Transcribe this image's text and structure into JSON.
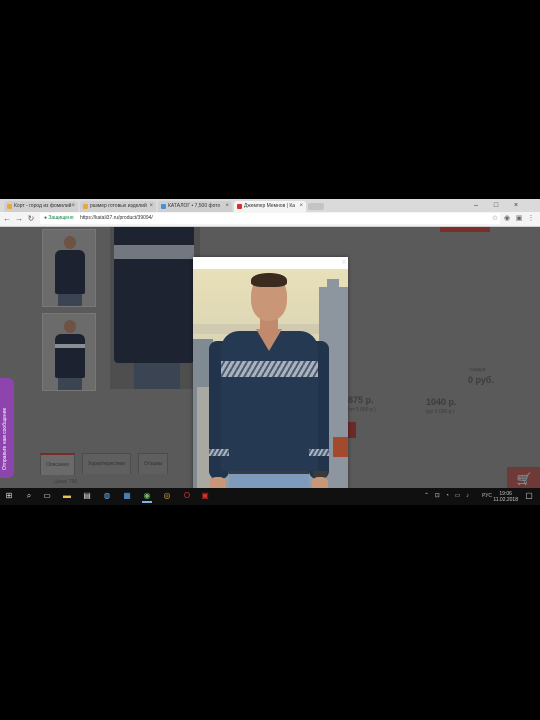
{
  "browser": {
    "tabs": [
      {
        "label": "Корт - город из фомилий",
        "active": false,
        "favicon_color": "#e8a93b"
      },
      {
        "label": "размер готовых изделий",
        "active": false,
        "favicon_color": "#e8a93b"
      },
      {
        "label": "КАТАЛОГ • 7,500 фото",
        "active": false,
        "favicon_color": "#4a90d9"
      },
      {
        "label": "Джемпер Мемнов | Ка",
        "active": true,
        "favicon_color": "#d9302a"
      }
    ],
    "window_controls": {
      "minimize": "–",
      "maximize": "□",
      "close": "×"
    },
    "address": {
      "secure_label": "● Защищено",
      "url": "https://katali37.ru/product/39094/"
    }
  },
  "page": {
    "price_note": "скидка",
    "price_right": "0 руб.",
    "price_1": "875 р.",
    "price_1_sub": "(от 5 000 р.)",
    "price_2": "1040 р.",
    "price_2_sub": "(до 5 000 р.)",
    "product_tabs": [
      "Описание",
      "Характеристики",
      "Отзывы"
    ],
    "footer_text": "Цена: 790",
    "cart_icon": "cart-icon"
  },
  "modal": {
    "close_symbol": "×",
    "image_subject": "man-in-navy-v-neck-sweater"
  },
  "feedback_tab": {
    "label": "Отправьте нам сообщение"
  },
  "taskbar": {
    "time": "19:06",
    "date": "11.02.2018",
    "language": "РУС",
    "tray_icons": "⌃ ⊡ ◔ ▭ ♪"
  },
  "colors": {
    "accent_red": "#7a2a26",
    "feedback_purple": "#8e44ad",
    "sweater_navy": "#253952"
  }
}
